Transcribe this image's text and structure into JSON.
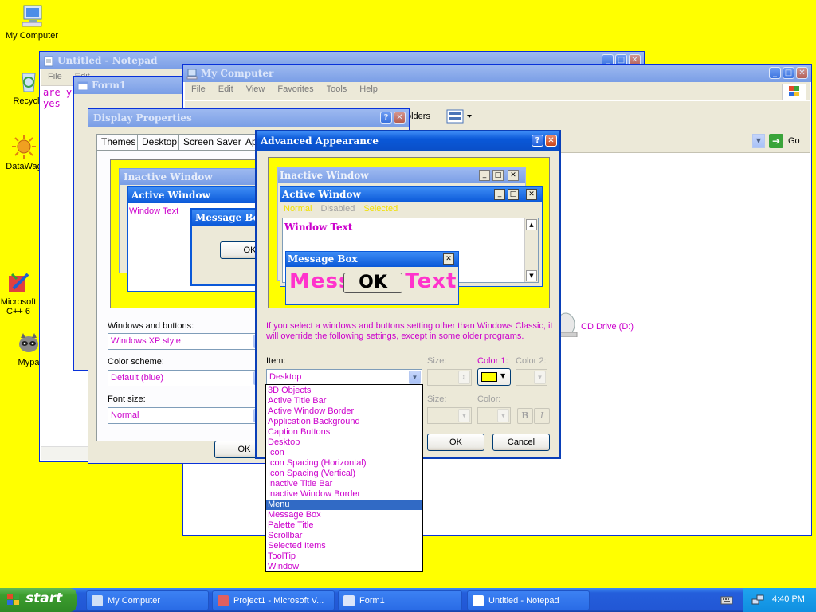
{
  "colors": {
    "desktop": "#ffff00",
    "accent": "#cc00cc",
    "title_active": "#0a58d8",
    "taskbar": "#245edb",
    "start": "#3c9d2e"
  },
  "desktop": {
    "icons": [
      "My Computer",
      "Recycle",
      "DataWag",
      "Microsoft C++ 6",
      "Mypa"
    ]
  },
  "notepad": {
    "title": "Untitled - Notepad",
    "menu": [
      "File",
      "Edit"
    ],
    "lines": [
      "are y",
      "yes"
    ]
  },
  "form1": {
    "title": "Form1"
  },
  "mycomputer": {
    "title": "My Computer",
    "menu": [
      "File",
      "Edit",
      "View",
      "Favorites",
      "Tools",
      "Help"
    ],
    "folders_label": "olders",
    "go_label": "Go",
    "drive_label": "CD Drive (D:)"
  },
  "display": {
    "title": "Display Properties",
    "tabs": [
      "Themes",
      "Desktop",
      "Screen Saver",
      "Ap"
    ],
    "preview": {
      "inactive_title": "Inactive Window",
      "active_title": "Active Window",
      "window_text": "Window Text",
      "msgbox_title": "Message Bo",
      "ok_label": "OK"
    },
    "windows_buttons_label": "Windows and buttons:",
    "windows_buttons_value": "Windows XP style",
    "color_scheme_label": "Color scheme:",
    "color_scheme_value": "Default (blue)",
    "font_size_label": "Font size:",
    "font_size_value": "Normal",
    "ok_label": "OK"
  },
  "advanced": {
    "title": "Advanced Appearance",
    "preview": {
      "inactive_title": "Inactive Window",
      "active_title": "Active Window",
      "menu_normal": "Normal",
      "menu_disabled": "Disabled",
      "menu_selected": "Selected",
      "window_text": "Window Text",
      "msgbox_title": "Message Box",
      "msgbox_text": "Message Text",
      "ok_label": "OK"
    },
    "info_text": "If you select a windows and buttons setting other than Windows Classic, it will override the following settings, except in some older programs.",
    "item_label": "Item:",
    "item_value": "Desktop",
    "size_label": "Size:",
    "color1_label": "Color 1:",
    "color2_label": "Color 2:",
    "font_size_label": "Size:",
    "font_color_label": "Color:",
    "color1_value": "#ffff00",
    "bold_label": "B",
    "italic_label": "I",
    "items": [
      "3D Objects",
      "Active Title Bar",
      "Active Window Border",
      "Application Background",
      "Caption Buttons",
      "Desktop",
      "Icon",
      "Icon Spacing (Horizontal)",
      "Icon Spacing (Vertical)",
      "Inactive Title Bar",
      "Inactive Window Border",
      "Menu",
      "Message Box",
      "Palette Title",
      "Scrollbar",
      "Selected Items",
      "ToolTip",
      "Window"
    ],
    "selected_item": "Menu",
    "ok_label": "OK",
    "cancel_label": "Cancel"
  },
  "taskbar": {
    "start_label": "start",
    "tasks": [
      "My Computer",
      "Project1 - Microsoft V...",
      "Form1",
      "Untitled - Notepad"
    ],
    "clock": "4:40 PM"
  }
}
